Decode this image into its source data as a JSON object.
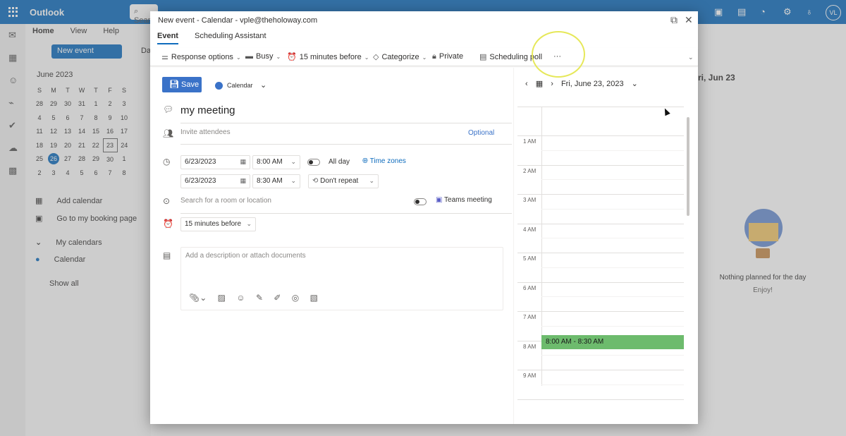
{
  "app": {
    "brand": "Outlook",
    "search_placeholder": "Search",
    "avatar_initials": "VL"
  },
  "ribbon_bg": {
    "tabs": [
      "Home",
      "View",
      "Help"
    ],
    "new_event": "New event",
    "day_label": "Da"
  },
  "mini_calendar": {
    "month": "June 2023",
    "weekdays": [
      "S",
      "M",
      "T",
      "W",
      "T",
      "F",
      "S"
    ],
    "weeks": [
      [
        "28",
        "29",
        "30",
        "31",
        "1",
        "2",
        "3"
      ],
      [
        "4",
        "5",
        "6",
        "7",
        "8",
        "9",
        "10"
      ],
      [
        "11",
        "12",
        "13",
        "14",
        "15",
        "16",
        "17"
      ],
      [
        "18",
        "19",
        "20",
        "21",
        "22",
        "23",
        "24"
      ],
      [
        "25",
        "26",
        "27",
        "28",
        "29",
        "30",
        "1"
      ],
      [
        "2",
        "3",
        "4",
        "5",
        "6",
        "7",
        "8"
      ]
    ],
    "today": "26",
    "selected": "23"
  },
  "left_links": {
    "add_calendar": "Add calendar",
    "booking": "Go to my booking page",
    "my_calendars": "My calendars",
    "calendar": "Calendar",
    "show_all": "Show all"
  },
  "right_pane": {
    "date_header": "ri, Jun 23",
    "empty_title": "Nothing planned for the day",
    "empty_sub": "Enjoy!"
  },
  "dialog": {
    "title": "New event - Calendar - vple@theholoway.com",
    "tabs": [
      "Event",
      "Scheduling Assistant"
    ],
    "ribbon": {
      "response_options": "Response options",
      "busy": "Busy",
      "reminder": "15 minutes before",
      "categorize": "Categorize",
      "private": "Private",
      "scheduling_poll": "Scheduling poll",
      "more": "···"
    },
    "save": "Save",
    "calendar": "Calendar",
    "event_title": "my meeting",
    "attendees_placeholder": "Invite attendees",
    "optional": "Optional",
    "start_date": "6/23/2023",
    "start_time": "8:00 AM",
    "all_day": "All day",
    "time_zones": "Time zones",
    "end_date": "6/23/2023",
    "end_time": "8:30 AM",
    "repeat": "Don't repeat",
    "location_placeholder": "Search for a room or location",
    "teams": "Teams meeting",
    "reminder": "15 minutes before",
    "description_placeholder": "Add a description or attach documents"
  },
  "day_view": {
    "date": "Fri, June 23, 2023",
    "hours": [
      "1 AM",
      "2 AM",
      "3 AM",
      "4 AM",
      "5 AM",
      "6 AM",
      "7 AM",
      "8 AM",
      "9 AM"
    ],
    "event_label": "8:00 AM - 8:30 AM"
  }
}
